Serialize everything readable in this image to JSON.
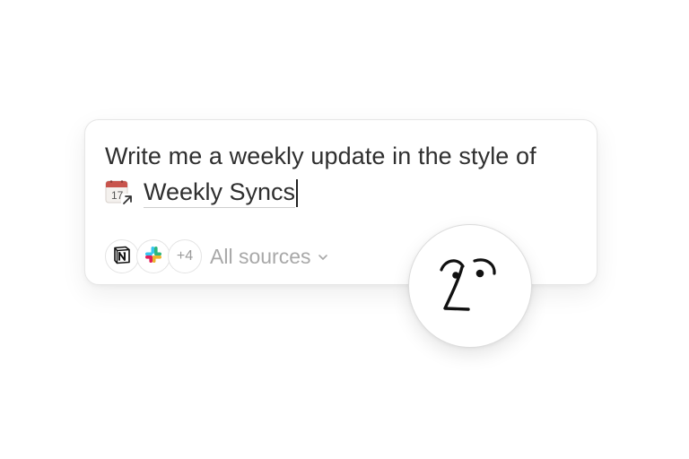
{
  "prompt": {
    "text": "Write me a weekly update in the style of",
    "mention_icon": "calendar-link-icon",
    "mention_label": "Weekly Syncs"
  },
  "sources": {
    "icons": [
      "notion-icon",
      "slack-icon"
    ],
    "more_count": "+4",
    "selector_label": "All sources",
    "selector_icon": "chevron-down-icon"
  },
  "assistant": {
    "icon": "notion-ai-face-icon"
  },
  "colors": {
    "text": "#2f2f2f",
    "muted": "#a8a8a8",
    "border": "#e6e6e6",
    "calendar_red": "#c8544c"
  }
}
